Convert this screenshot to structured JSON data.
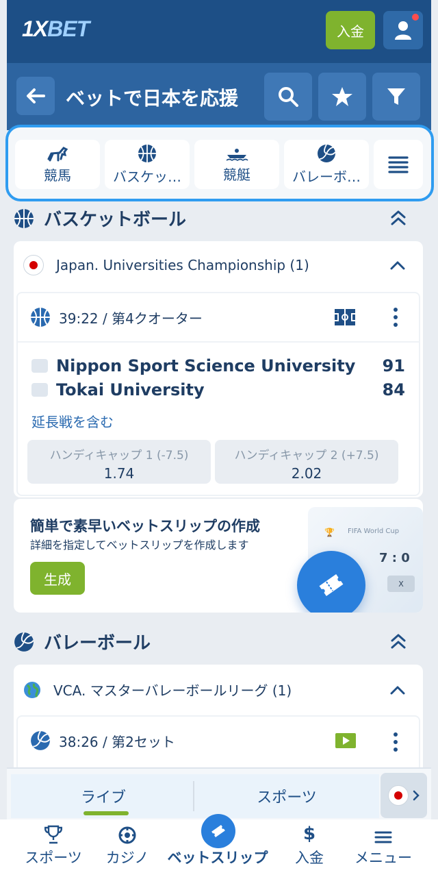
{
  "header": {
    "logo_main": "1X",
    "logo_accent": "BET",
    "deposit_label": "入金"
  },
  "subheader": {
    "title": "ベットで日本を応援"
  },
  "categories": [
    {
      "label": "競馬",
      "icon": "horse-icon"
    },
    {
      "label": "バスケッ…",
      "icon": "basketball-icon"
    },
    {
      "label": "競艇",
      "icon": "boat-icon"
    },
    {
      "label": "バレーボ…",
      "icon": "volleyball-icon"
    }
  ],
  "basketball_section": {
    "title": "バスケットボール",
    "league": "Japan. Universities Championship (1)",
    "match": {
      "time": "39:22 / 第4クオーター",
      "team1": "Nippon Sport Science University",
      "team2": "Tokai University",
      "score1": "91",
      "score2": "84",
      "note": "延長戦を含む",
      "odds": [
        {
          "label": "ハンディキャップ 1 (-7.5)",
          "value": "1.74"
        },
        {
          "label": "ハンディキャップ 2 (+7.5)",
          "value": "2.02"
        }
      ]
    }
  },
  "promo": {
    "title": "簡単で素早いベットスリップの作成",
    "subtitle": "詳細を指定してベットスリップを作成します",
    "button": "生成",
    "art_caption": "FIFA World Cup",
    "art_score": "7 : 0",
    "art_box": "X"
  },
  "volleyball_section": {
    "title": "バレーボール",
    "league": "VCA. マスターバレーボールリーグ (1)",
    "match": {
      "time": "38:26 / 第2セット"
    }
  },
  "switcher": {
    "live": "ライブ",
    "sports": "スポーツ"
  },
  "bottom_nav": {
    "sports": "スポーツ",
    "casino": "カジノ",
    "betslip": "ベットスリップ",
    "deposit": "入金",
    "menu": "メニュー"
  },
  "colors": {
    "brand_dark": "#1d4f86",
    "brand": "#2d64a0",
    "accent_green": "#7fb32e",
    "accent_blue": "#2a7fdc"
  }
}
